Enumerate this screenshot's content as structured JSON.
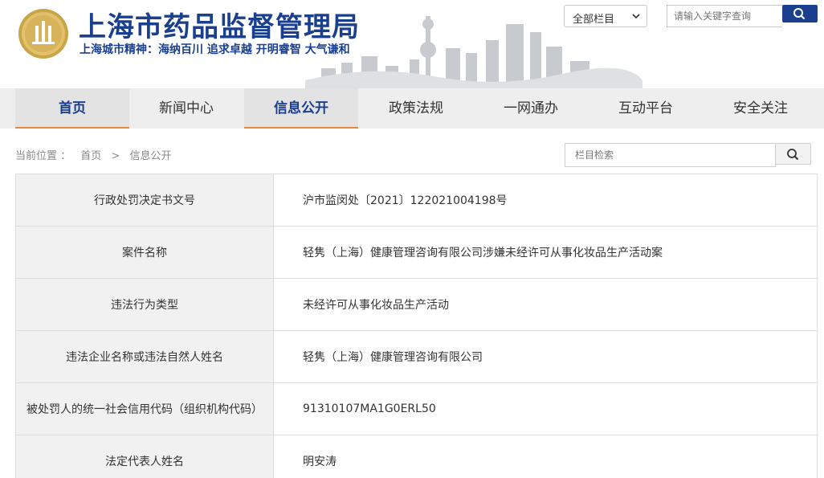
{
  "header": {
    "title": "上海市药品监督管理局",
    "motto": "上海城市精神：海纳百川  追求卓越  开明睿智  大气谦和",
    "scope_select": "全部栏目",
    "search_placeholder": "请输入关键字查询",
    "brand_color": "#1a3f8f"
  },
  "nav": {
    "items": [
      {
        "label": "首页"
      },
      {
        "label": "新闻中心"
      },
      {
        "label": "信息公开"
      },
      {
        "label": "政策法规"
      },
      {
        "label": "一网通办"
      },
      {
        "label": "互动平台"
      },
      {
        "label": "安全关注"
      }
    ],
    "accent_color": "#e58a3a"
  },
  "breadcrumb": {
    "prefix": "当前位置 ：",
    "home": "首页",
    "separator": ">",
    "current": "信息公开"
  },
  "column_search": {
    "placeholder": "栏目检索"
  },
  "detail": {
    "rows": [
      {
        "label": "行政处罚决定书文号",
        "value": "沪市监闵处〔2021〕122021004198号"
      },
      {
        "label": "案件名称",
        "value": "轻隽（上海）健康管理咨询有限公司涉嫌未经许可从事化妆品生产活动案"
      },
      {
        "label": "违法行为类型",
        "value": "未经许可从事化妆品生产活动"
      },
      {
        "label": "违法企业名称或违法自然人姓名",
        "value": "轻隽（上海）健康管理咨询有限公司"
      },
      {
        "label": "被处罚人的统一社会信用代码（组织机构代码）",
        "value": "91310107MA1G0ERL50"
      },
      {
        "label": "法定代表人姓名",
        "value": "明安涛"
      }
    ]
  }
}
